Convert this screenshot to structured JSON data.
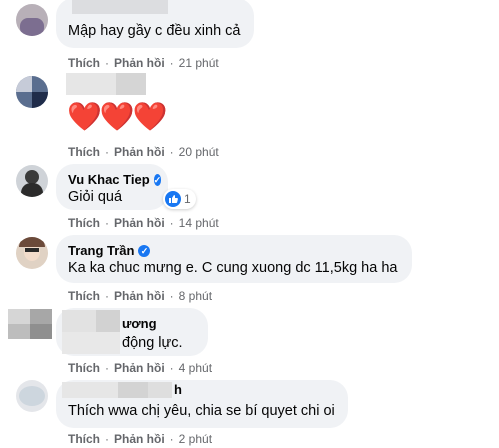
{
  "comments": [
    {
      "text": "Mập hay gầy c đều xinh cả",
      "actions": {
        "like": "Thích",
        "reply": "Phản hồi",
        "time": "21 phút"
      }
    },
    {
      "emoji": "❤️❤️❤️",
      "actions": {
        "like": "Thích",
        "reply": "Phản hồi",
        "time": "20 phút"
      }
    },
    {
      "name": "Vu Khac Tiep",
      "text": "Giỏi quá",
      "reaction_count": "1",
      "actions": {
        "like": "Thích",
        "reply": "Phản hồi",
        "time": "14 phút"
      }
    },
    {
      "name": "Trang Trần",
      "text": "Ka ka chuc mưng e. C cung xuong dc 11,5kg ha ha",
      "actions": {
        "like": "Thích",
        "reply": "Phản hồi",
        "time": "8 phút"
      }
    },
    {
      "name_partial": "ương",
      "text_partial": "động lực.",
      "actions": {
        "like": "Thích",
        "reply": "Phản hồi",
        "time": "4 phút"
      }
    },
    {
      "name_partial": "h",
      "text": "Thích wwa chị yêu, chia se bí quyet chi oi",
      "actions": {
        "like": "Thích",
        "reply": "Phản hồi",
        "time": "2 phút"
      }
    }
  ],
  "colors": {
    "verified": "#1877f2",
    "bubble": "#f0f2f5",
    "meta": "#65676b",
    "heart": "#e4323f"
  }
}
